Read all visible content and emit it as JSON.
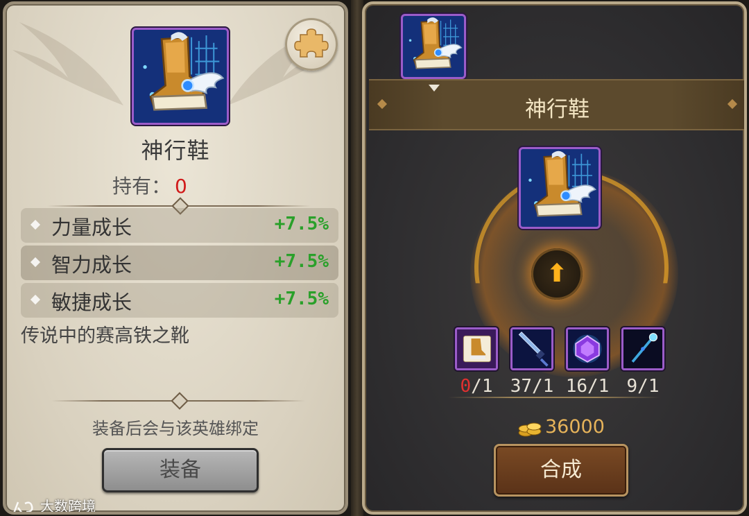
{
  "item": {
    "name": "神行鞋",
    "icon": "winged-boot-icon"
  },
  "left": {
    "hold_label": "持有：",
    "hold_value": "0",
    "stats": [
      {
        "label": "力量成长",
        "value": "+7.5%"
      },
      {
        "label": "智力成长",
        "value": "+7.5%"
      },
      {
        "label": "敏捷成长",
        "value": "+7.5%"
      }
    ],
    "description": "传说中的赛高铁之靴",
    "bind_notice": "装备后会与该英雄绑定",
    "equip_button": "装备",
    "watermark": "大数跨境"
  },
  "right": {
    "title": "神行鞋",
    "materials": [
      {
        "icon": "boot-scroll-icon",
        "have": "0",
        "need": "/1",
        "short": true
      },
      {
        "icon": "sword-icon",
        "have": "37",
        "need": "/1",
        "short": false
      },
      {
        "icon": "purple-gem-icon",
        "have": "16",
        "need": "/1",
        "short": false
      },
      {
        "icon": "staff-icon",
        "have": "9",
        "need": "/1",
        "short": false
      }
    ],
    "cost": "36000",
    "craft_button": "合成"
  },
  "colors": {
    "stat_value": "#2aa02a",
    "hold_value": "#d11a1a",
    "material_short": "#e23030",
    "gold": "#e6b35a"
  }
}
